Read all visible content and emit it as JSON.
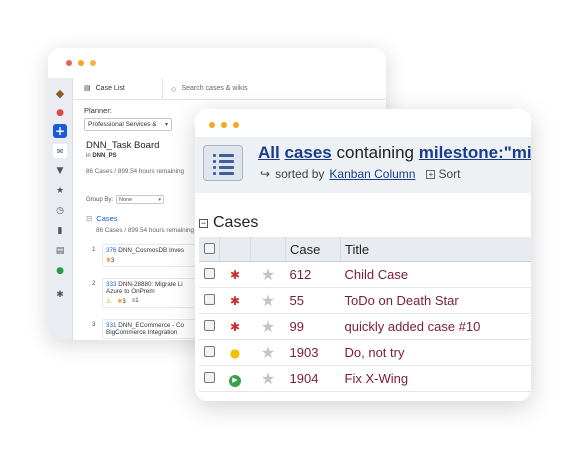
{
  "back_window": {
    "tab_case_list": "Case List",
    "search_placeholder": "Search cases & wikis",
    "planner_label": "Planner:",
    "planner_value": "Professional Services &",
    "board_title": "DNN_Task Board",
    "board_in_prefix": "in",
    "board_in_project": "DNN_PS",
    "board_count": "86 Cases / 899.54 hours remaining",
    "group_by_label": "Group By:",
    "group_by_value": "None",
    "cases_heading": "Cases",
    "cases_count": "86 Cases / 899.54 hours remaining",
    "cards": [
      {
        "index": "1",
        "id": "376",
        "title": "DNN_CosmosDB Inves",
        "title2": "",
        "a": "3",
        "b": ""
      },
      {
        "index": "2",
        "id": "333",
        "title": "DNN-28880: Migrate Li",
        "title2": "Azure to OnPrem",
        "a": "3",
        "b": "1"
      },
      {
        "index": "3",
        "id": "331",
        "title": "DNN_ECommerce - Co",
        "title2": "BigCommerce Integration",
        "a": "",
        "b": ""
      }
    ],
    "rail_icons": [
      "logo-icon",
      "bell-icon",
      "plus-icon",
      "mail-icon",
      "filter-icon",
      "star-icon",
      "clock-icon",
      "chart-icon",
      "document-icon",
      "person-icon",
      "settings-icon"
    ]
  },
  "front_window": {
    "title_all": "All",
    "title_cases": "cases",
    "title_containing": "containing",
    "title_milestone": "milestone:\"mile",
    "sorted_by": "sorted by",
    "sorted_field": "Kanban Column",
    "sort_button": "Sort",
    "section_title": "Cases",
    "columns": [
      "",
      "",
      "",
      "Case",
      "Title"
    ],
    "rows": [
      {
        "icon": "bug-icon",
        "case": "612",
        "title": "Child Case"
      },
      {
        "icon": "bug-icon",
        "case": "55",
        "title": "ToDo on Death Star"
      },
      {
        "icon": "bug-icon",
        "case": "99",
        "title": "quickly added case #10"
      },
      {
        "icon": "lightbulb-icon",
        "case": "1903",
        "title": "Do, not try"
      },
      {
        "icon": "play-icon",
        "case": "1904",
        "title": "Fix X-Wing"
      }
    ]
  }
}
